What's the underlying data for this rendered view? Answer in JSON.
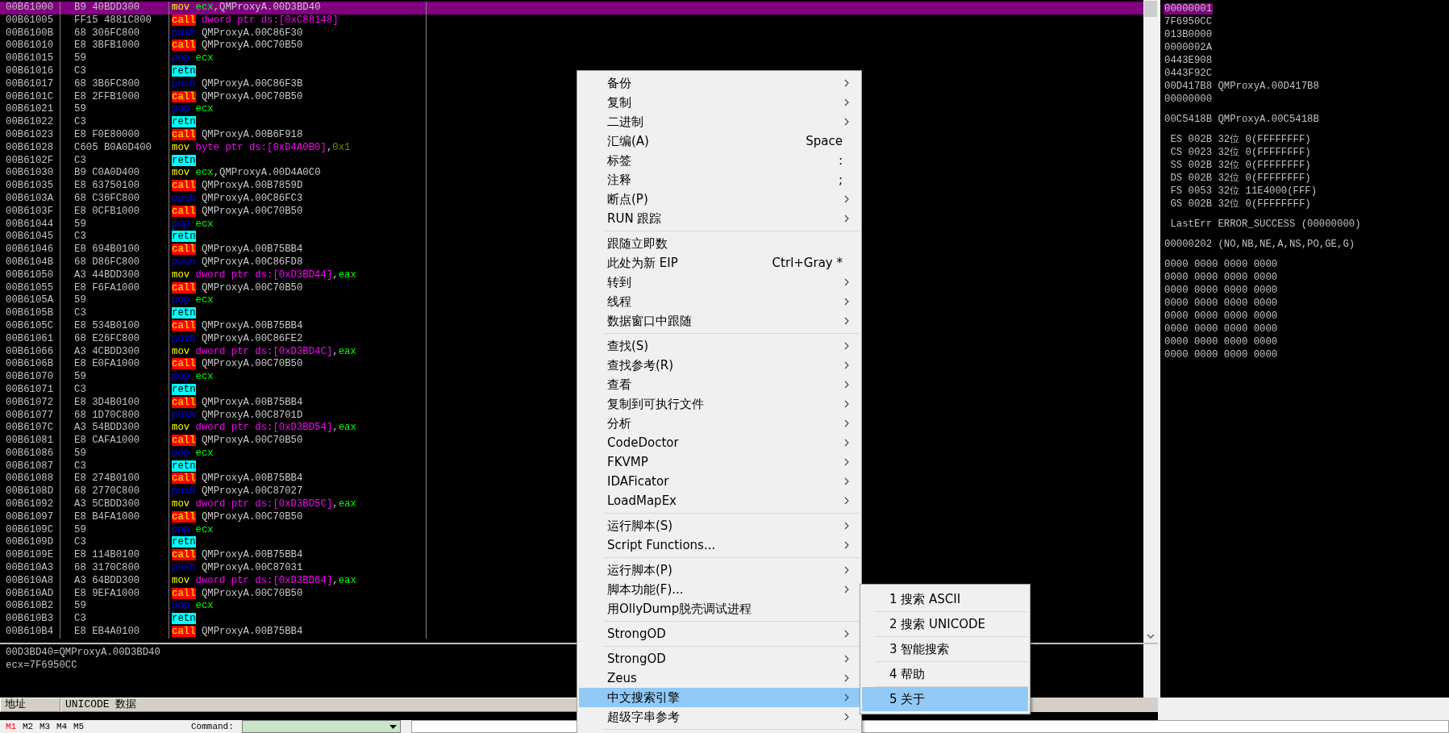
{
  "disassembly": {
    "rows": [
      {
        "address": "00B61000",
        "hex": "B9 40BDD300",
        "mnemonic": "mov",
        "kind": "mov",
        "operand": [
          {
            "text": "ecx",
            "kind": "register"
          },
          {
            "text": ",",
            "kind": "punct"
          },
          {
            "text": "QMProxyA.00D3BD40",
            "kind": "symbol"
          }
        ],
        "selected": true
      },
      {
        "address": "00B61005",
        "hex": "FF15 4881C800",
        "mnemonic": "call",
        "kind": "call",
        "operand": [
          {
            "text": "dword ptr ds:[0xC88148]",
            "kind": "memory"
          }
        ],
        "selected": false
      },
      {
        "address": "00B6100B",
        "hex": "68 306FC800",
        "mnemonic": "push",
        "kind": "push",
        "operand": [
          {
            "text": "QMProxyA.00C86F30",
            "kind": "symbol"
          }
        ],
        "selected": false
      },
      {
        "address": "00B61010",
        "hex": "E8 3BFB1000",
        "mnemonic": "call",
        "kind": "call",
        "operand": [
          {
            "text": "QMProxyA.00C70B50",
            "kind": "symbol"
          }
        ],
        "selected": false
      },
      {
        "address": "00B61015",
        "hex": "59",
        "mnemonic": "pop",
        "kind": "pop",
        "operand": [
          {
            "text": "ecx",
            "kind": "register"
          }
        ],
        "selected": false
      },
      {
        "address": "00B61016",
        "hex": "C3",
        "mnemonic": "retn",
        "kind": "retn",
        "selected": false
      },
      {
        "address": "00B61017",
        "hex": "68 3B6FC800",
        "mnemonic": "push",
        "kind": "push",
        "operand": [
          {
            "text": "QMProxyA.00C86F3B",
            "kind": "symbol"
          }
        ],
        "selected": false
      },
      {
        "address": "00B6101C",
        "hex": "E8 2FFB1000",
        "mnemonic": "call",
        "kind": "call",
        "operand": [
          {
            "text": "QMProxyA.00C70B50",
            "kind": "symbol"
          }
        ],
        "selected": false
      },
      {
        "address": "00B61021",
        "hex": "59",
        "mnemonic": "pop",
        "kind": "pop",
        "operand": [
          {
            "text": "ecx",
            "kind": "register"
          }
        ],
        "selected": false
      },
      {
        "address": "00B61022",
        "hex": "C3",
        "mnemonic": "retn",
        "kind": "retn",
        "selected": false
      },
      {
        "address": "00B61023",
        "hex": "E8 F0E80000",
        "mnemonic": "call",
        "kind": "call",
        "operand": [
          {
            "text": "QMProxyA.00B6F918",
            "kind": "symbol"
          }
        ],
        "selected": false
      },
      {
        "address": "00B61028",
        "hex": "C605 B0A0D400",
        "mnemonic": "mov",
        "kind": "mov",
        "operand": [
          {
            "text": "byte ptr ds:[0xD4A0B0]",
            "kind": "memory"
          },
          {
            "text": ",",
            "kind": "punct"
          },
          {
            "text": "0x1",
            "kind": "constant"
          }
        ],
        "selected": false
      },
      {
        "address": "00B6102F",
        "hex": "C3",
        "mnemonic": "retn",
        "kind": "retn",
        "selected": false
      },
      {
        "address": "00B61030",
        "hex": "B9 C0A0D400",
        "mnemonic": "mov",
        "kind": "mov",
        "operand": [
          {
            "text": "ecx",
            "kind": "register"
          },
          {
            "text": ",",
            "kind": "punct"
          },
          {
            "text": "QMProxyA.00D4A0C0",
            "kind": "symbol"
          }
        ],
        "selected": false
      },
      {
        "address": "00B61035",
        "hex": "E8 63750100",
        "mnemonic": "call",
        "kind": "call",
        "operand": [
          {
            "text": "QMProxyA.00B7859D",
            "kind": "symbol"
          }
        ],
        "selected": false
      },
      {
        "address": "00B6103A",
        "hex": "68 C36FC800",
        "mnemonic": "push",
        "kind": "push",
        "operand": [
          {
            "text": "QMProxyA.00C86FC3",
            "kind": "symbol"
          }
        ],
        "selected": false
      },
      {
        "address": "00B6103F",
        "hex": "E8 0CFB1000",
        "mnemonic": "call",
        "kind": "call",
        "operand": [
          {
            "text": "QMProxyA.00C70B50",
            "kind": "symbol"
          }
        ],
        "selected": false
      },
      {
        "address": "00B61044",
        "hex": "59",
        "mnemonic": "pop",
        "kind": "pop",
        "operand": [
          {
            "text": "ecx",
            "kind": "register"
          }
        ],
        "selected": false
      },
      {
        "address": "00B61045",
        "hex": "C3",
        "mnemonic": "retn",
        "kind": "retn",
        "selected": false
      },
      {
        "address": "00B61046",
        "hex": "E8 694B0100",
        "mnemonic": "call",
        "kind": "call",
        "operand": [
          {
            "text": "QMProxyA.00B75BB4",
            "kind": "symbol"
          }
        ],
        "selected": false
      },
      {
        "address": "00B6104B",
        "hex": "68 D86FC800",
        "mnemonic": "push",
        "kind": "push",
        "operand": [
          {
            "text": "QMProxyA.00C86FD8",
            "kind": "symbol"
          }
        ],
        "selected": false
      },
      {
        "address": "00B61050",
        "hex": "A3 44BDD300",
        "mnemonic": "mov",
        "kind": "mov",
        "operand": [
          {
            "text": "dword ptr ds:[0xD3BD44]",
            "kind": "memory"
          },
          {
            "text": ",",
            "kind": "punct"
          },
          {
            "text": "eax",
            "kind": "register"
          }
        ],
        "selected": false
      },
      {
        "address": "00B61055",
        "hex": "E8 F6FA1000",
        "mnemonic": "call",
        "kind": "call",
        "operand": [
          {
            "text": "QMProxyA.00C70B50",
            "kind": "symbol"
          }
        ],
        "selected": false
      },
      {
        "address": "00B6105A",
        "hex": "59",
        "mnemonic": "pop",
        "kind": "pop",
        "operand": [
          {
            "text": "ecx",
            "kind": "register"
          }
        ],
        "selected": false
      },
      {
        "address": "00B6105B",
        "hex": "C3",
        "mnemonic": "retn",
        "kind": "retn",
        "selected": false
      },
      {
        "address": "00B6105C",
        "hex": "E8 534B0100",
        "mnemonic": "call",
        "kind": "call",
        "operand": [
          {
            "text": "QMProxyA.00B75BB4",
            "kind": "symbol"
          }
        ],
        "selected": false
      },
      {
        "address": "00B61061",
        "hex": "68 E26FC800",
        "mnemonic": "push",
        "kind": "push",
        "operand": [
          {
            "text": "QMProxyA.00C86FE2",
            "kind": "symbol"
          }
        ],
        "selected": false
      },
      {
        "address": "00B61066",
        "hex": "A3 4CBDD300",
        "mnemonic": "mov",
        "kind": "mov",
        "operand": [
          {
            "text": "dword ptr ds:[0xD3BD4C]",
            "kind": "memory"
          },
          {
            "text": ",",
            "kind": "punct"
          },
          {
            "text": "eax",
            "kind": "register"
          }
        ],
        "selected": false
      },
      {
        "address": "00B6106B",
        "hex": "E8 E0FA1000",
        "mnemonic": "call",
        "kind": "call",
        "operand": [
          {
            "text": "QMProxyA.00C70B50",
            "kind": "symbol"
          }
        ],
        "selected": false
      },
      {
        "address": "00B61070",
        "hex": "59",
        "mnemonic": "pop",
        "kind": "pop",
        "operand": [
          {
            "text": "ecx",
            "kind": "register"
          }
        ],
        "selected": false
      },
      {
        "address": "00B61071",
        "hex": "C3",
        "mnemonic": "retn",
        "kind": "retn",
        "selected": false
      },
      {
        "address": "00B61072",
        "hex": "E8 3D4B0100",
        "mnemonic": "call",
        "kind": "call",
        "operand": [
          {
            "text": "QMProxyA.00B75BB4",
            "kind": "symbol"
          }
        ],
        "selected": false
      },
      {
        "address": "00B61077",
        "hex": "68 1D70C800",
        "mnemonic": "push",
        "kind": "push",
        "operand": [
          {
            "text": "QMProxyA.00C8701D",
            "kind": "symbol"
          }
        ],
        "selected": false
      },
      {
        "address": "00B6107C",
        "hex": "A3 54BDD300",
        "mnemonic": "mov",
        "kind": "mov",
        "operand": [
          {
            "text": "dword ptr ds:[0xD3BD54]",
            "kind": "memory"
          },
          {
            "text": ",",
            "kind": "punct"
          },
          {
            "text": "eax",
            "kind": "register"
          }
        ],
        "selected": false
      },
      {
        "address": "00B61081",
        "hex": "E8 CAFA1000",
        "mnemonic": "call",
        "kind": "call",
        "operand": [
          {
            "text": "QMProxyA.00C70B50",
            "kind": "symbol"
          }
        ],
        "selected": false
      },
      {
        "address": "00B61086",
        "hex": "59",
        "mnemonic": "pop",
        "kind": "pop",
        "operand": [
          {
            "text": "ecx",
            "kind": "register"
          }
        ],
        "selected": false
      },
      {
        "address": "00B61087",
        "hex": "C3",
        "mnemonic": "retn",
        "kind": "retn",
        "selected": false
      },
      {
        "address": "00B61088",
        "hex": "E8 274B0100",
        "mnemonic": "call",
        "kind": "call",
        "operand": [
          {
            "text": "QMProxyA.00B75BB4",
            "kind": "symbol"
          }
        ],
        "selected": false
      },
      {
        "address": "00B6108D",
        "hex": "68 2770C800",
        "mnemonic": "push",
        "kind": "push",
        "operand": [
          {
            "text": "QMProxyA.00C87027",
            "kind": "symbol"
          }
        ],
        "selected": false
      },
      {
        "address": "00B61092",
        "hex": "A3 5CBDD300",
        "mnemonic": "mov",
        "kind": "mov",
        "operand": [
          {
            "text": "dword ptr ds:[0xD3BD5C]",
            "kind": "memory"
          },
          {
            "text": ",",
            "kind": "punct"
          },
          {
            "text": "eax",
            "kind": "register"
          }
        ],
        "selected": false
      },
      {
        "address": "00B61097",
        "hex": "E8 B4FA1000",
        "mnemonic": "call",
        "kind": "call",
        "operand": [
          {
            "text": "QMProxyA.00C70B50",
            "kind": "symbol"
          }
        ],
        "selected": false
      },
      {
        "address": "00B6109C",
        "hex": "59",
        "mnemonic": "pop",
        "kind": "pop",
        "operand": [
          {
            "text": "ecx",
            "kind": "register"
          }
        ],
        "selected": false
      },
      {
        "address": "00B6109D",
        "hex": "C3",
        "mnemonic": "retn",
        "kind": "retn",
        "selected": false
      },
      {
        "address": "00B6109E",
        "hex": "E8 114B0100",
        "mnemonic": "call",
        "kind": "call",
        "operand": [
          {
            "text": "QMProxyA.00B75BB4",
            "kind": "symbol"
          }
        ],
        "selected": false
      },
      {
        "address": "00B610A3",
        "hex": "68 3170C800",
        "mnemonic": "push",
        "kind": "push",
        "operand": [
          {
            "text": "QMProxyA.00C87031",
            "kind": "symbol"
          }
        ],
        "selected": false
      },
      {
        "address": "00B610A8",
        "hex": "A3 64BDD300",
        "mnemonic": "mov",
        "kind": "mov",
        "operand": [
          {
            "text": "dword ptr ds:[0xD3BD64]",
            "kind": "memory"
          },
          {
            "text": ",",
            "kind": "punct"
          },
          {
            "text": "eax",
            "kind": "register"
          }
        ],
        "selected": false
      },
      {
        "address": "00B610AD",
        "hex": "E8 9EFA1000",
        "mnemonic": "call",
        "kind": "call",
        "operand": [
          {
            "text": "QMProxyA.00C70B50",
            "kind": "symbol"
          }
        ],
        "selected": false
      },
      {
        "address": "00B610B2",
        "hex": "59",
        "mnemonic": "pop",
        "kind": "pop",
        "operand": [
          {
            "text": "ecx",
            "kind": "register"
          }
        ],
        "selected": false
      },
      {
        "address": "00B610B3",
        "hex": "C3",
        "mnemonic": "retn",
        "kind": "retn",
        "selected": false
      },
      {
        "address": "00B610B4",
        "hex": "E8 EB4A0100",
        "mnemonic": "call",
        "kind": "call",
        "operand": [
          {
            "text": "QMProxyA.00B75BB4",
            "kind": "symbol"
          }
        ],
        "selected": false
      }
    ]
  },
  "info": {
    "lines": [
      "00D3BD40=QMProxyA.00D3BD40",
      "ecx=7F6950CC"
    ]
  },
  "registers": {
    "groups": [
      {
        "lines": [
          {
            "text": "00000001",
            "selected": true
          },
          {
            "text": "7F6950CC",
            "selected": false
          },
          {
            "text": "013B0000",
            "selected": false
          },
          {
            "text": "0000002A",
            "selected": false
          },
          {
            "text": "0443E908",
            "selected": false
          },
          {
            "text": "0443F92C",
            "selected": false
          },
          {
            "text": "00D417B8 QMProxyA.00D417B8",
            "selected": false
          },
          {
            "text": "00000000",
            "selected": false
          }
        ]
      },
      {
        "lines": [
          {
            "text": "00C5418B QMProxyA.00C5418B",
            "selected": false
          }
        ]
      },
      {
        "lines": [
          {
            "text": " ES 002B 32位 0(FFFFFFFF)",
            "selected": false
          },
          {
            "text": " CS 0023 32位 0(FFFFFFFF)",
            "selected": false
          },
          {
            "text": " SS 002B 32位 0(FFFFFFFF)",
            "selected": false
          },
          {
            "text": " DS 002B 32位 0(FFFFFFFF)",
            "selected": false
          },
          {
            "text": " FS 0053 32位 11E4000(FFF)",
            "selected": false
          },
          {
            "text": " GS 002B 32位 0(FFFFFFFF)",
            "selected": false
          }
        ]
      },
      {
        "lines": [
          {
            "text": " LastErr ERROR_SUCCESS (00000000)",
            "selected": false
          }
        ]
      },
      {
        "lines": [
          {
            "text": "00000202 (NO,NB,NE,A,NS,PO,GE,G)",
            "selected": false
          }
        ]
      },
      {
        "lines": [
          {
            "text": "0000 0000 0000 0000",
            "selected": false
          },
          {
            "text": "0000 0000 0000 0000",
            "selected": false
          },
          {
            "text": "0000 0000 0000 0000",
            "selected": false
          },
          {
            "text": "0000 0000 0000 0000",
            "selected": false
          },
          {
            "text": "0000 0000 0000 0000",
            "selected": false
          },
          {
            "text": "0000 0000 0000 0000",
            "selected": false
          },
          {
            "text": "0000 0000 0000 0000",
            "selected": false
          },
          {
            "text": "0000 0000 0000 0000",
            "selected": false
          }
        ]
      }
    ]
  },
  "dump": {
    "columns": [
      "地址",
      "UNICODE 数据"
    ]
  },
  "command_bar": {
    "memory_tabs": [
      {
        "label": "M1",
        "selected": true
      },
      {
        "label": "M2",
        "selected": false
      },
      {
        "label": "M3",
        "selected": false
      },
      {
        "label": "M4",
        "selected": false
      },
      {
        "label": "M5",
        "selected": false
      }
    ],
    "command_label": "Command:"
  },
  "context_menu": {
    "groups": [
      {
        "items": [
          {
            "label": "备份",
            "submenu": true,
            "selected": false
          },
          {
            "label": "复制",
            "submenu": true,
            "selected": false
          },
          {
            "label": "二进制",
            "submenu": true,
            "selected": false
          },
          {
            "label": "汇编(A)",
            "shortcut": "Space",
            "submenu": false,
            "selected": false
          },
          {
            "label": "标签",
            "shortcut": ":",
            "submenu": false,
            "selected": false
          },
          {
            "label": "注释",
            "shortcut": ";",
            "submenu": false,
            "selected": false
          },
          {
            "label": "断点(P)",
            "submenu": true,
            "selected": false
          },
          {
            "label": "RUN 跟踪",
            "submenu": true,
            "selected": false
          }
        ]
      },
      {
        "items": [
          {
            "label": "跟随立即数",
            "submenu": false,
            "selected": false
          },
          {
            "label": "此处为新 EIP",
            "shortcut": "Ctrl+Gray *",
            "submenu": false,
            "selected": false
          },
          {
            "label": "转到",
            "submenu": true,
            "selected": false
          },
          {
            "label": "线程",
            "submenu": true,
            "selected": false
          },
          {
            "label": "数据窗口中跟随",
            "submenu": true,
            "selected": false
          }
        ]
      },
      {
        "items": [
          {
            "label": "查找(S)",
            "submenu": true,
            "selected": false
          },
          {
            "label": "查找参考(R)",
            "submenu": true,
            "selected": false
          },
          {
            "label": "查看",
            "submenu": true,
            "selected": false
          },
          {
            "label": "复制到可执行文件",
            "submenu": true,
            "selected": false
          },
          {
            "label": "分析",
            "submenu": true,
            "selected": false
          },
          {
            "label": "CodeDoctor",
            "submenu": true,
            "selected": false
          },
          {
            "label": "FKVMP",
            "submenu": true,
            "selected": false
          },
          {
            "label": "IDAFicator",
            "submenu": true,
            "selected": false
          },
          {
            "label": "LoadMapEx",
            "submenu": true,
            "selected": false
          }
        ]
      },
      {
        "items": [
          {
            "label": "运行脚本(S)",
            "submenu": true,
            "selected": false
          },
          {
            "label": "Script Functions...",
            "submenu": true,
            "selected": false
          }
        ]
      },
      {
        "items": [
          {
            "label": "运行脚本(P)",
            "submenu": true,
            "selected": false
          },
          {
            "label": "脚本功能(F)...",
            "submenu": true,
            "selected": false
          },
          {
            "label": "用OllyDump脱壳调试进程",
            "submenu": false,
            "selected": false
          }
        ]
      },
      {
        "items": [
          {
            "label": "StrongOD",
            "submenu": true,
            "selected": false
          }
        ]
      },
      {
        "items": [
          {
            "label": "StrongOD",
            "submenu": true,
            "selected": false
          },
          {
            "label": "Zeus",
            "submenu": true,
            "selected": false
          },
          {
            "label": "中文搜索引擎",
            "submenu": true,
            "selected": true
          },
          {
            "label": "超级字串参考",
            "submenu": true,
            "selected": false
          }
        ]
      }
    ]
  },
  "submenu": {
    "items": [
      {
        "label": "1 搜索 ASCII",
        "selected": false
      },
      {
        "label": "2 搜索 UNICODE",
        "selected": false
      },
      {
        "label": "3 智能搜索",
        "selected": false
      },
      {
        "label": "4 帮助",
        "selected": false
      },
      {
        "label": "5 关于",
        "selected": true
      }
    ]
  }
}
